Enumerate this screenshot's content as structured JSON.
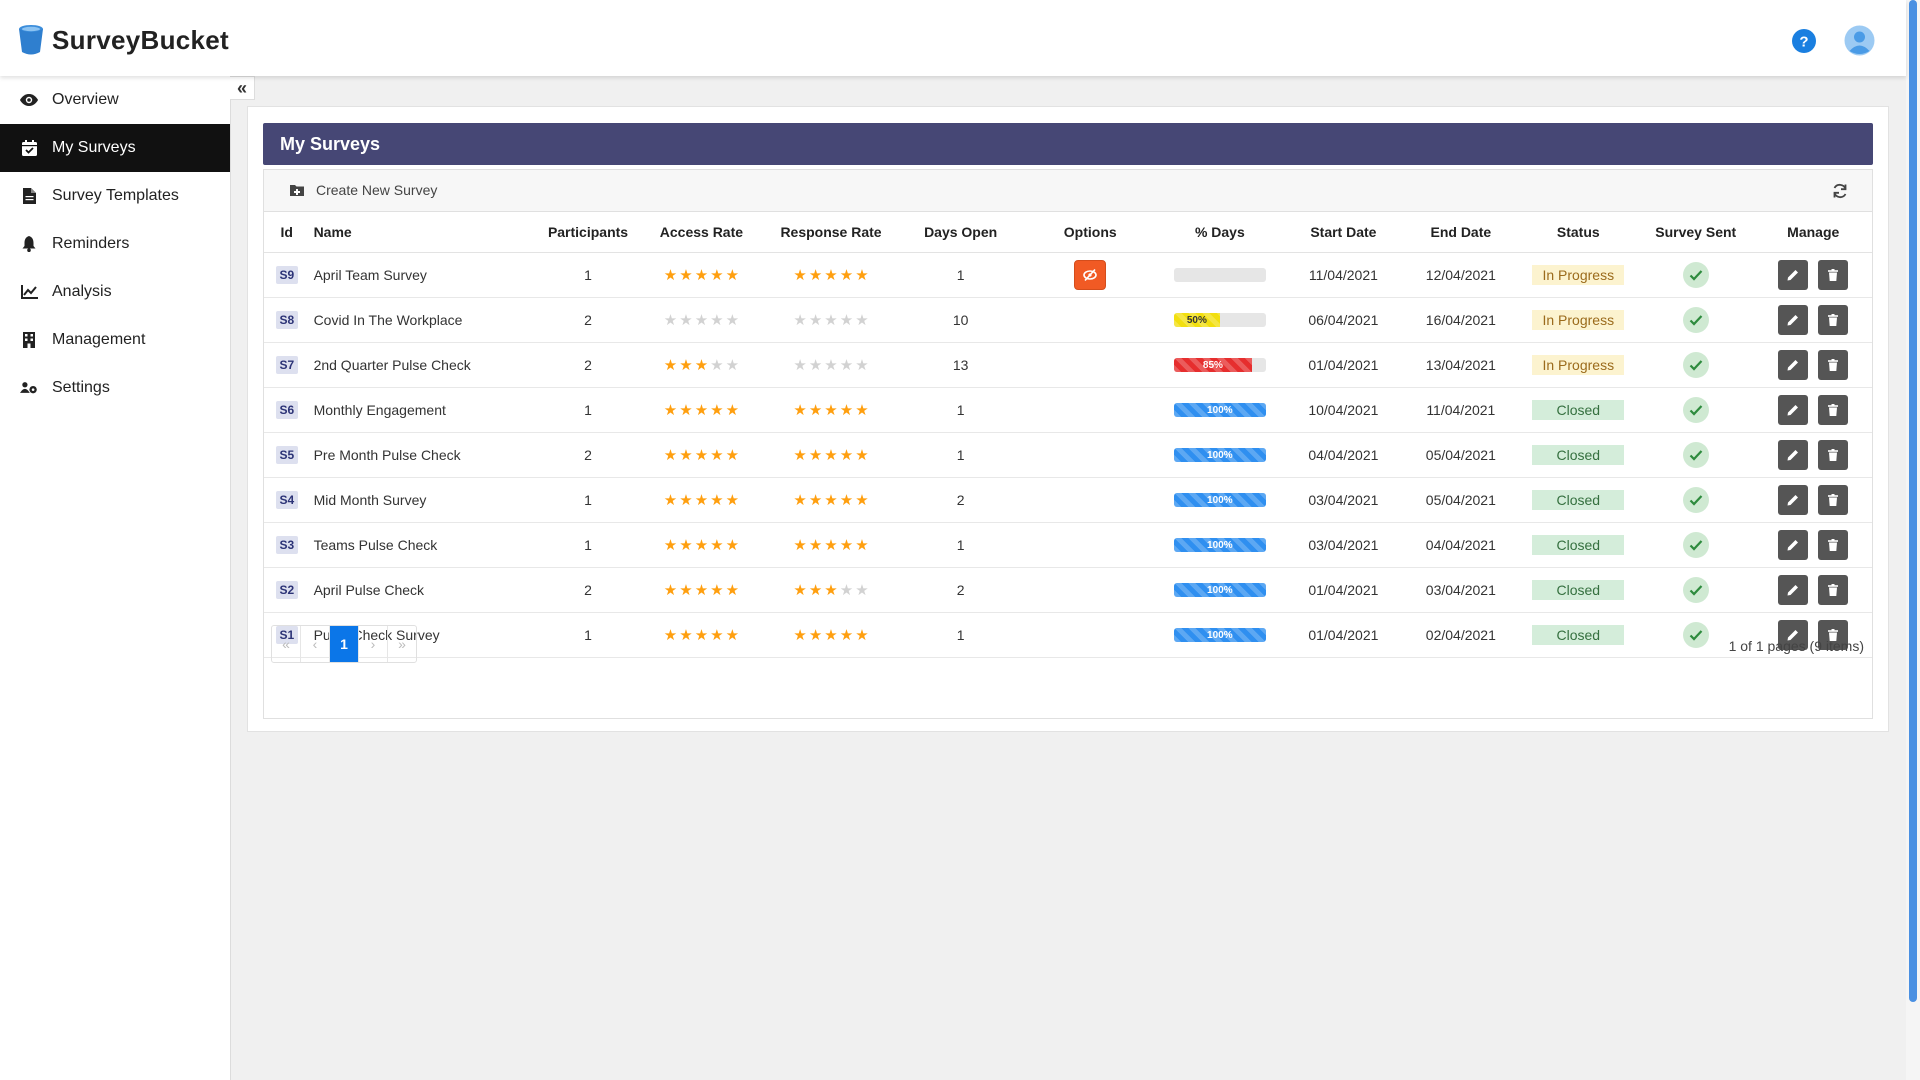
{
  "app": {
    "title": "SurveyBucket"
  },
  "header": {
    "help_icon": "question-circle-icon",
    "avatar_icon": "user-avatar-icon"
  },
  "sidebar": {
    "collapse_label": "«",
    "items": [
      {
        "label": "Overview",
        "icon": "eye-icon"
      },
      {
        "label": "My Surveys",
        "icon": "calendar-check-icon",
        "active": true
      },
      {
        "label": "Survey Templates",
        "icon": "file-icon"
      },
      {
        "label": "Reminders",
        "icon": "bell-icon"
      },
      {
        "label": "Analysis",
        "icon": "line-chart-icon"
      },
      {
        "label": "Management",
        "icon": "building-icon"
      },
      {
        "label": "Settings",
        "icon": "users-gear-icon"
      }
    ]
  },
  "main": {
    "title": "My Surveys",
    "toolbar": {
      "create_label": "Create New Survey"
    },
    "columns": [
      "Id",
      "Name",
      "Participants",
      "Access Rate",
      "Response Rate",
      "Days Open",
      "Options",
      "% Days",
      "Start Date",
      "End Date",
      "Status",
      "Survey Sent",
      "Manage"
    ],
    "rows": [
      {
        "id": "S9",
        "name": "April Team Survey",
        "participants": "1",
        "access_rate": 5,
        "response_rate": 5,
        "days_open": "1",
        "has_option": true,
        "pct_days": 0,
        "pct_label": "",
        "start": "11/04/2021",
        "end": "12/04/2021",
        "status": "In Progress"
      },
      {
        "id": "S8",
        "name": "Covid In The Workplace",
        "participants": "2",
        "access_rate": 0,
        "response_rate": 0,
        "days_open": "10",
        "has_option": false,
        "pct_days": 50,
        "pct_label": "50%",
        "start": "06/04/2021",
        "end": "16/04/2021",
        "status": "In Progress"
      },
      {
        "id": "S7",
        "name": "2nd Quarter Pulse Check",
        "participants": "2",
        "access_rate": 2.5,
        "response_rate": 0,
        "days_open": "13",
        "has_option": false,
        "pct_days": 85,
        "pct_label": "85%",
        "start": "01/04/2021",
        "end": "13/04/2021",
        "status": "In Progress"
      },
      {
        "id": "S6",
        "name": "Monthly Engagement",
        "participants": "1",
        "access_rate": 5,
        "response_rate": 5,
        "days_open": "1",
        "has_option": false,
        "pct_days": 100,
        "pct_label": "100%",
        "start": "10/04/2021",
        "end": "11/04/2021",
        "status": "Closed"
      },
      {
        "id": "S5",
        "name": "Pre Month Pulse Check",
        "participants": "2",
        "access_rate": 5,
        "response_rate": 5,
        "days_open": "1",
        "has_option": false,
        "pct_days": 100,
        "pct_label": "100%",
        "start": "04/04/2021",
        "end": "05/04/2021",
        "status": "Closed"
      },
      {
        "id": "S4",
        "name": "Mid Month Survey",
        "participants": "1",
        "access_rate": 5,
        "response_rate": 5,
        "days_open": "2",
        "has_option": false,
        "pct_days": 100,
        "pct_label": "100%",
        "start": "03/04/2021",
        "end": "05/04/2021",
        "status": "Closed"
      },
      {
        "id": "S3",
        "name": "Teams Pulse Check",
        "participants": "1",
        "access_rate": 5,
        "response_rate": 5,
        "days_open": "1",
        "has_option": false,
        "pct_days": 100,
        "pct_label": "100%",
        "start": "03/04/2021",
        "end": "04/04/2021",
        "status": "Closed"
      },
      {
        "id": "S2",
        "name": "April Pulse Check",
        "participants": "2",
        "access_rate": 5,
        "response_rate": 2.5,
        "days_open": "2",
        "has_option": false,
        "pct_days": 100,
        "pct_label": "100%",
        "start": "01/04/2021",
        "end": "03/04/2021",
        "status": "Closed"
      },
      {
        "id": "S1",
        "name": "Pulse Check Survey",
        "participants": "1",
        "access_rate": 5,
        "response_rate": 5,
        "days_open": "1",
        "has_option": false,
        "pct_days": 100,
        "pct_label": "100%",
        "start": "01/04/2021",
        "end": "02/04/2021",
        "status": "Closed"
      }
    ],
    "pager": {
      "first": "«",
      "prev": "‹",
      "current": "1",
      "next": "›",
      "last": "»",
      "info": "1 of 1 pages (9 items)"
    }
  },
  "colors": {
    "title_bar": "#464775",
    "accent": "#0b76e8",
    "star": "#ff9f0f"
  }
}
